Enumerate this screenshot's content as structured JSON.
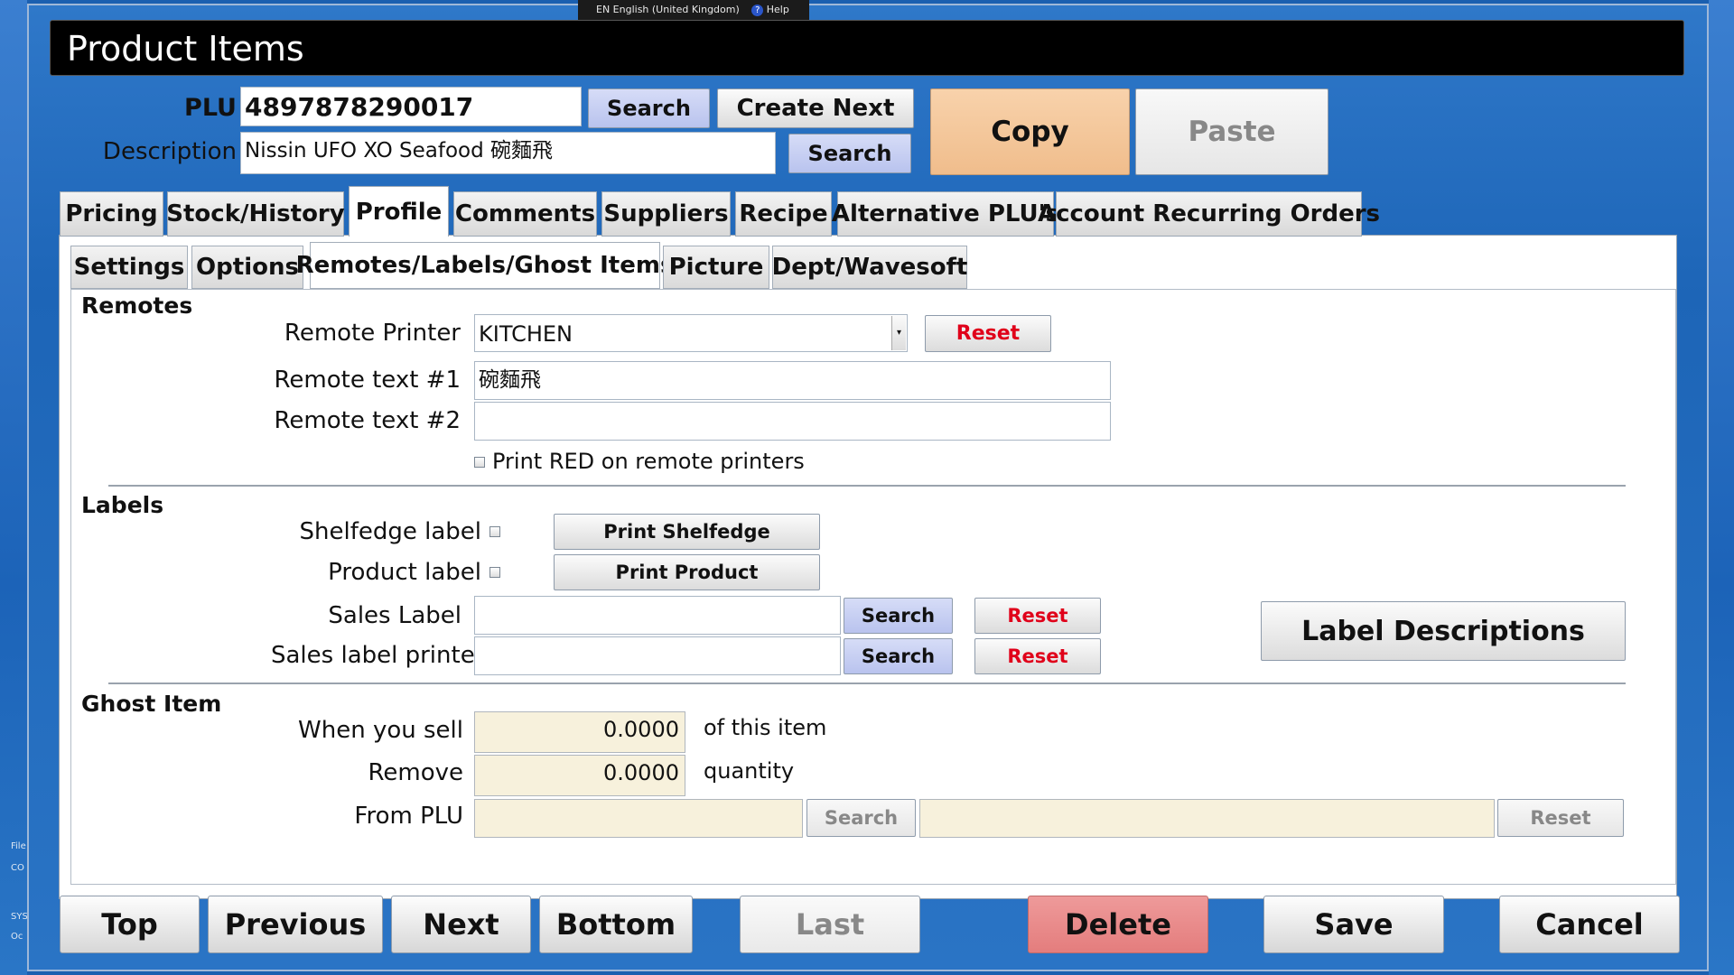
{
  "desktop": {
    "left_snippets": [
      "File",
      "CO",
      "SYS",
      "Oc"
    ]
  },
  "langbar": {
    "language": "EN English (United Kingdom)",
    "help": "Help"
  },
  "window": {
    "title": "Product Items"
  },
  "header": {
    "plu_label": "PLU",
    "plu_value": "4897878290017",
    "plu_search": "Search",
    "create_next": "Create Next",
    "description_label": "Description",
    "description_value": "Nissin UFO XO Seafood 碗麵飛",
    "description_search": "Search",
    "copy": "Copy",
    "paste": "Paste"
  },
  "tabs": [
    "Pricing",
    "Stock/History",
    "Profile",
    "Comments",
    "Suppliers",
    "Recipe",
    "Alternative PLU's",
    "Account Recurring Orders"
  ],
  "active_tab": "Profile",
  "subtabs": [
    "Settings",
    "Options",
    "Remotes/Labels/Ghost Items",
    "Picture",
    "Dept/Wavesoft"
  ],
  "active_subtab": "Remotes/Labels/Ghost Items",
  "remotes": {
    "heading": "Remotes",
    "printer_label": "Remote Printer",
    "printer_value": "KITCHEN",
    "printer_reset": "Reset",
    "text1_label": "Remote text #1",
    "text1_value": "碗麵飛",
    "text2_label": "Remote text #2",
    "text2_value": "",
    "print_red_label": "Print RED on remote printers",
    "print_red_checked": false
  },
  "labels": {
    "heading": "Labels",
    "shelfedge_label": "Shelfedge label",
    "shelfedge_checked": false,
    "print_shelfedge": "Print Shelfedge",
    "product_label": "Product label",
    "product_checked": false,
    "print_product": "Print Product",
    "sales_label": "Sales Label",
    "sales_label_value": "",
    "sales_label_search": "Search",
    "sales_label_reset": "Reset",
    "sales_printer": "Sales label printer",
    "sales_printer_value": "",
    "sales_printer_search": "Search",
    "sales_printer_reset": "Reset",
    "label_descriptions": "Label Descriptions"
  },
  "ghost": {
    "heading": "Ghost Item",
    "when_sell_label": "When you sell",
    "when_sell_value": "0.0000",
    "of_item": "of this item",
    "remove_label": "Remove",
    "remove_value": "0.0000",
    "quantity": "quantity",
    "from_plu_label": "From PLU",
    "from_plu_value": "",
    "from_plu_search": "Search",
    "from_plu_desc": "",
    "from_plu_reset": "Reset"
  },
  "footer": {
    "top": "Top",
    "previous": "Previous",
    "next": "Next",
    "bottom": "Bottom",
    "last": "Last",
    "delete": "Delete",
    "save": "Save",
    "cancel": "Cancel"
  },
  "colors": {
    "copy_button": "#f3c79c",
    "delete_button": "#e98b8b",
    "search_button": "#c4ccf2",
    "reset_text": "#e0001a",
    "ghost_field": "#f7f1dc"
  }
}
